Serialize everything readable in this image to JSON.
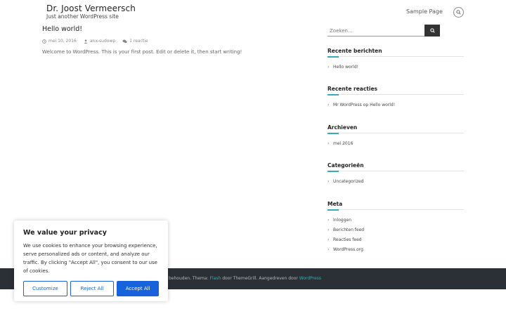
{
  "header": {
    "site_title": "Dr. Joost Vermeersch",
    "tagline": "Just another WordPress site",
    "nav_link": "Sample Page"
  },
  "post": {
    "title": "Hello world!",
    "date": "mei 10, 2016",
    "author": "anx-sudowp",
    "comments": "1 reactie",
    "content": "Welcome to WordPress. This is your first post. Edit or delete it, then start writing!"
  },
  "sidebar": {
    "search_placeholder": "Zoeken...",
    "widgets": [
      {
        "title": "Recente berichten",
        "items": [
          "Hello world!"
        ]
      },
      {
        "title": "Recente reacties",
        "items": [
          {
            "author": "Mr WordPress",
            "sep": "op",
            "post": "Hello world!"
          }
        ]
      },
      {
        "title": "Archieven",
        "items": [
          "mei 2016"
        ]
      },
      {
        "title": "Categorieën",
        "items": [
          "Uncategorized"
        ]
      },
      {
        "title": "Meta",
        "items": [
          "Inloggen",
          "Berichten feed",
          "Reacties feed",
          "WordPress.org"
        ]
      }
    ]
  },
  "footer": {
    "text_prefix": "behouden. Thema:",
    "theme": "Flash",
    "by": "door ThemeGrill. Aangedreven door",
    "platform": "WordPress"
  },
  "cookie": {
    "title": "We value your privacy",
    "body": "We use cookies to enhance your browsing experience, serve personalized ads or content, and analyze our traffic. By clicking \"Accept All\", you consent to our use of cookies.",
    "customize": "Customize",
    "reject": "Reject All",
    "accept": "Accept All"
  },
  "colors": {
    "accent": "#30afb8",
    "button_blue": "#1863dc",
    "footer_bg": "#2b2f36"
  }
}
